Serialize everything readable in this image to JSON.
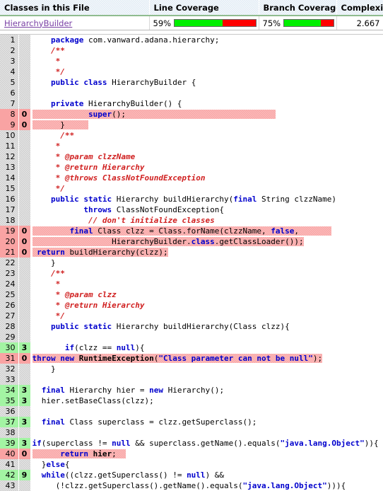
{
  "summary": {
    "headers": {
      "classes": "Classes in this File",
      "line_coverage": "Line Coverage",
      "branch_coverage": "Branch Coverage",
      "complexity": "Complexity"
    },
    "row": {
      "class_name": "HierarchyBuilder",
      "line_coverage_pct": "59%",
      "line_coverage_value": 59,
      "branch_coverage_pct": "75%",
      "branch_coverage_value": 75,
      "complexity": "2.667"
    },
    "colors": {
      "covered": "#00ef00",
      "missed": "#ff0000",
      "link": "#7a41a5",
      "header_bg": "#dfeaf4"
    }
  },
  "source": {
    "lines": [
      {
        "n": "1",
        "hits": "",
        "state": "none",
        "code": "    <span class=\"kw\">package</span> com.vanward.adana.hierarchy;"
      },
      {
        "n": "2",
        "hits": "",
        "state": "none",
        "code": "    <span class=\"cm\">/**</span>"
      },
      {
        "n": "3",
        "hits": "",
        "state": "none",
        "code": "     <span class=\"cm\">*</span>"
      },
      {
        "n": "4",
        "hits": "",
        "state": "none",
        "code": "     <span class=\"cm\">*/</span>"
      },
      {
        "n": "5",
        "hits": "",
        "state": "none",
        "code": "    <span class=\"kw\">public class</span> HierarchyBuilder {"
      },
      {
        "n": "6",
        "hits": "",
        "state": "none",
        "code": ""
      },
      {
        "n": "7",
        "hits": "",
        "state": "none",
        "code": "    <span class=\"kw\">private</span> HierarchyBuilder() {"
      },
      {
        "n": "8",
        "hits": "0",
        "state": "missed",
        "code": "<span class=\"hl\">            <span class=\"kw\">super</span>();                                </span>"
      },
      {
        "n": "9",
        "hits": "0",
        "state": "missed",
        "code": "<span class=\"hl\">      }     </span>"
      },
      {
        "n": "10",
        "hits": "",
        "state": "none",
        "code": "      <span class=\"cm\">/**</span>"
      },
      {
        "n": "11",
        "hits": "",
        "state": "none",
        "code": "     <span class=\"cm\">*</span>"
      },
      {
        "n": "12",
        "hits": "",
        "state": "none",
        "code": "     <span class=\"cm\">* @param clzzName</span>"
      },
      {
        "n": "13",
        "hits": "",
        "state": "none",
        "code": "     <span class=\"cm\">* @return Hierarchy</span>"
      },
      {
        "n": "14",
        "hits": "",
        "state": "none",
        "code": "     <span class=\"cm\">* @throws ClassNotFoundException</span>"
      },
      {
        "n": "15",
        "hits": "",
        "state": "none",
        "code": "     <span class=\"cm\">*/</span>"
      },
      {
        "n": "16",
        "hits": "",
        "state": "none",
        "code": "    <span class=\"kw\">public static</span> Hierarchy buildHierarchy(<span class=\"kw\">final</span> String clzzName)"
      },
      {
        "n": "17",
        "hits": "",
        "state": "none",
        "code": "           <span class=\"kw\">throws</span> ClassNotFoundException{"
      },
      {
        "n": "18",
        "hits": "",
        "state": "none",
        "code": "            <span class=\"cm\">// don't initialize classes</span>"
      },
      {
        "n": "19",
        "hits": "0",
        "state": "missed",
        "code": "<span class=\"hl\">        <span class=\"kw\">final</span> Class clzz = Class.forName(clzzName, <span class=\"kw\">false</span>,       </span>"
      },
      {
        "n": "20",
        "hits": "0",
        "state": "missed",
        "code": "<span class=\"hl\">                 HierarchyBuilder.<span class=\"kw\">class</span>.getClassLoader());</span>"
      },
      {
        "n": "21",
        "hits": "0",
        "state": "missed",
        "code": "<span class=\"hl\"> <span class=\"kw\">return</span> buildHierarchy(clzz);</span>"
      },
      {
        "n": "22",
        "hits": "",
        "state": "none",
        "code": "    }"
      },
      {
        "n": "23",
        "hits": "",
        "state": "none",
        "code": "    <span class=\"cm\">/**</span>"
      },
      {
        "n": "24",
        "hits": "",
        "state": "none",
        "code": "     <span class=\"cm\">*</span>"
      },
      {
        "n": "25",
        "hits": "",
        "state": "none",
        "code": "     <span class=\"cm\">* @param clzz</span>"
      },
      {
        "n": "26",
        "hits": "",
        "state": "none",
        "code": "     <span class=\"cm\">* @return Hierarchy</span>"
      },
      {
        "n": "27",
        "hits": "",
        "state": "none",
        "code": "     <span class=\"cm\">*/</span>"
      },
      {
        "n": "28",
        "hits": "",
        "state": "none",
        "code": "    <span class=\"kw\">public static</span> Hierarchy buildHierarchy(Class clzz){"
      },
      {
        "n": "29",
        "hits": "",
        "state": "none",
        "code": ""
      },
      {
        "n": "30",
        "hits": "3",
        "state": "covered",
        "code": "       <span class=\"kw\">if</span>(clzz == <span class=\"kw\">null</span>){"
      },
      {
        "n": "31",
        "hits": "0",
        "state": "missed",
        "code": "<span class=\"hl\"><span class=\"kw\">throw new</span> <span class=\"pl\">RuntimeException</span>(<span class=\"st\">\"Class parameter can not be null\"</span>);</span>"
      },
      {
        "n": "32",
        "hits": "",
        "state": "none",
        "code": "    }"
      },
      {
        "n": "33",
        "hits": "",
        "state": "none",
        "code": ""
      },
      {
        "n": "34",
        "hits": "3",
        "state": "covered",
        "code": "  <span class=\"kw\">final</span> Hierarchy hier = <span class=\"kw\">new</span> Hierarchy();"
      },
      {
        "n": "35",
        "hits": "3",
        "state": "covered",
        "code": "  hier.setBaseClass(clzz);"
      },
      {
        "n": "36",
        "hits": "",
        "state": "none",
        "code": ""
      },
      {
        "n": "37",
        "hits": "3",
        "state": "covered",
        "code": "  <span class=\"kw\">final</span> Class superclass = clzz.getSuperclass();"
      },
      {
        "n": "38",
        "hits": "",
        "state": "none",
        "code": ""
      },
      {
        "n": "39",
        "hits": "3",
        "state": "covered",
        "code": "<span class=\"kw\">if</span>(superclass != <span class=\"kw\">null</span> && superclass.getName().equals(<span class=\"st\">\"java.lang.Object\"</span>)){"
      },
      {
        "n": "40",
        "hits": "0",
        "state": "missed",
        "code": "<span class=\"hl\">      <span class=\"kw\">return</span> <span class=\"pl\">hier</span>;  </span>"
      },
      {
        "n": "41",
        "hits": "",
        "state": "none",
        "code": "  }<span class=\"kw\">else</span>{"
      },
      {
        "n": "42",
        "hits": "9",
        "state": "covered",
        "code": "  <span class=\"kw\">while</span>((clzz.getSuperclass() != <span class=\"kw\">null</span>) &&"
      },
      {
        "n": "43",
        "hits": "",
        "state": "none",
        "code": "     (!clzz.getSuperclass().getName().equals(<span class=\"st\">\"java.lang.Object\"</span>))){"
      }
    ]
  }
}
